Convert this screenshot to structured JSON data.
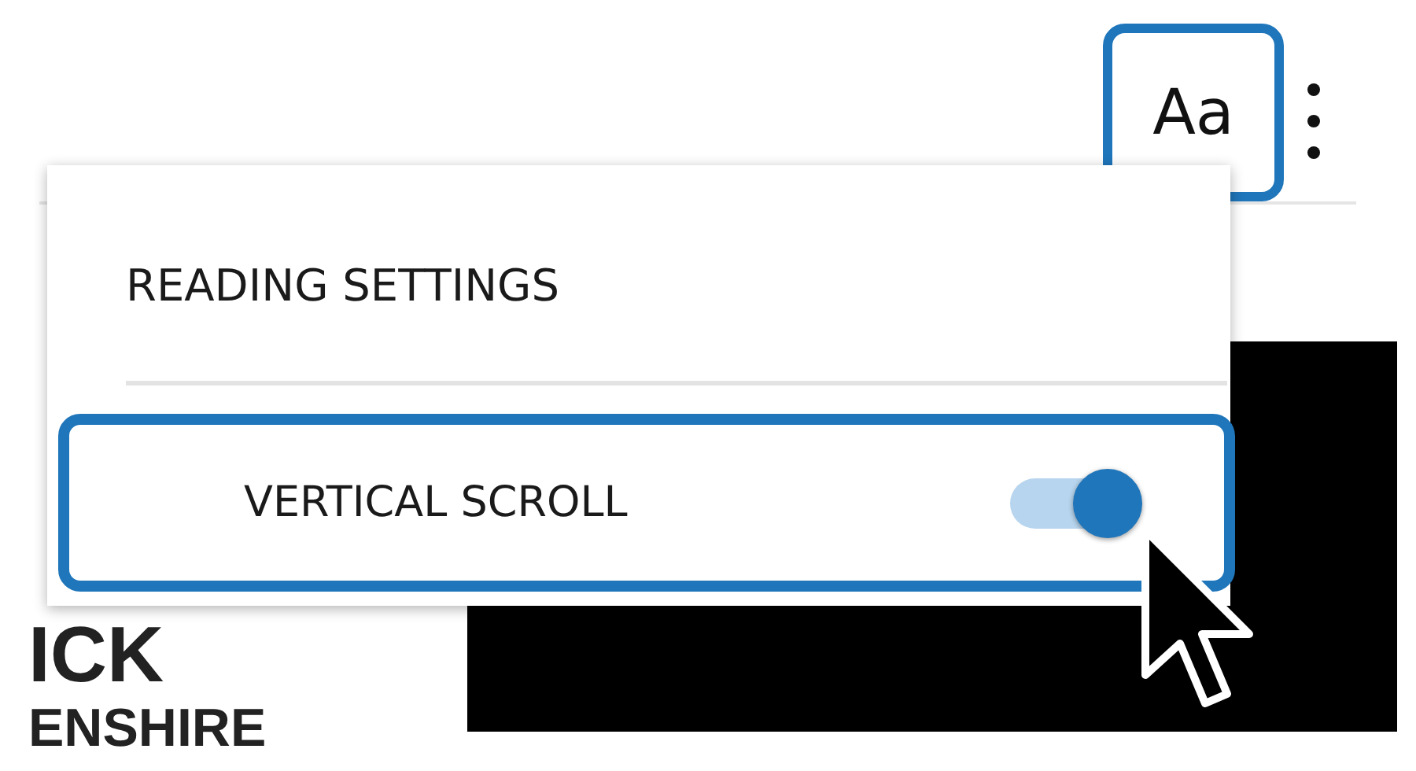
{
  "toolbar": {
    "font_button": {
      "label": "Aa",
      "highlighted": true
    }
  },
  "menu": {
    "title": "READING SETTINGS",
    "options": [
      {
        "kind": "toggle",
        "label": "VERTICAL SCROLL",
        "on": true,
        "highlighted": true
      }
    ]
  },
  "page": {
    "text_lines": [
      "ICK",
      "ENSHIRE"
    ]
  }
}
